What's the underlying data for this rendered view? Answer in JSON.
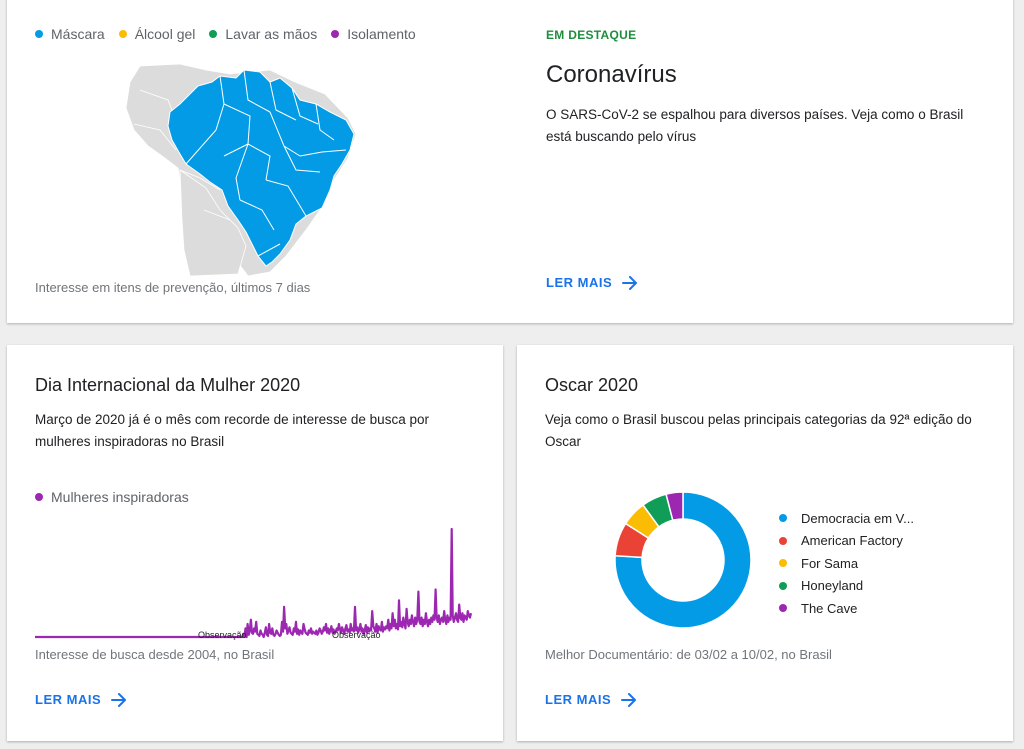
{
  "colors": {
    "mascara": "#039be5",
    "alcool": "#fbbc04",
    "lavar": "#0f9d58",
    "isolamento": "#9c27b0",
    "accent_blue": "#1a73e8",
    "accent_green": "#1e8e3e",
    "map_gray": "#dcdcdc",
    "brazil_blue": "#039be5"
  },
  "corona": {
    "legend": [
      {
        "label": "Máscara",
        "color": "#039be5"
      },
      {
        "label": "Álcool gel",
        "color": "#fbbc04"
      },
      {
        "label": "Lavar as mãos",
        "color": "#0f9d58"
      },
      {
        "label": "Isolamento",
        "color": "#9c27b0"
      }
    ],
    "map_caption": "Interesse em itens de prevenção, últimos 7 dias",
    "eyebrow": "EM DESTAQUE",
    "title": "Coronavírus",
    "description": "O SARS-CoV-2 se espalhou para diversos países. Veja como o Brasil está buscando pelo vírus",
    "read_more": "LER MAIS",
    "arrow_icon": "arrow-right-icon"
  },
  "mulher": {
    "title": "Dia Internacional da Mulher 2020",
    "description": "Março de 2020 já é o mês com recorde de interesse de busca por mulheres inspiradoras no Brasil",
    "legend_label": "Mulheres inspiradoras",
    "legend_color": "#9c27b0",
    "annotations": [
      "Observação",
      "Observação"
    ],
    "caption": "Interesse de busca desde 2004, no Brasil",
    "read_more": "LER MAIS"
  },
  "oscar": {
    "title": "Oscar 2020",
    "description": "Veja como o Brasil buscou pelas principais categorias da 92ª edição do Oscar",
    "caption": "Melhor Documentário: de 03/02 a 10/02, no Brasil",
    "read_more": "LER MAIS"
  },
  "chart_data": [
    {
      "type": "line",
      "series": [
        {
          "name": "Mulheres inspiradoras",
          "values": [
            0,
            0,
            0,
            0,
            0,
            0,
            0,
            0,
            0,
            0,
            0,
            0,
            0,
            0,
            0,
            0,
            0,
            0,
            0,
            0,
            0,
            0,
            0,
            0,
            0,
            0,
            0,
            0,
            0,
            0,
            0,
            0,
            0,
            0,
            0,
            0,
            0,
            0,
            0,
            0,
            0,
            0,
            0,
            0,
            0,
            0,
            0,
            0,
            0,
            0,
            0,
            0,
            0,
            0,
            0,
            0,
            0,
            0,
            0,
            0,
            0,
            0,
            0,
            0,
            0,
            0,
            0,
            0,
            0,
            0,
            0,
            0,
            0,
            0,
            0,
            0,
            0,
            0,
            0,
            0,
            0,
            0,
            0,
            0,
            0,
            0,
            0,
            0,
            0,
            0,
            0,
            0,
            0,
            0,
            0,
            0,
            0,
            0,
            0,
            0,
            0,
            0,
            0,
            0,
            0,
            0,
            0,
            0,
            0,
            0,
            0,
            0,
            0,
            0,
            0,
            0,
            0,
            0,
            0,
            0,
            0,
            0,
            0,
            0,
            0,
            0,
            0,
            0,
            0,
            0,
            0,
            0,
            0,
            0,
            0,
            0,
            0,
            0,
            0,
            0,
            0,
            0,
            0,
            0,
            0,
            0,
            0,
            0,
            0,
            0,
            0,
            0,
            0,
            0,
            0,
            0,
            0,
            0,
            0,
            0,
            0,
            0,
            0,
            0,
            0,
            0,
            0,
            0,
            0,
            0,
            0,
            0,
            0,
            0,
            0,
            0,
            0,
            0,
            0,
            0,
            0,
            0,
            0,
            0,
            0,
            0,
            0,
            0,
            0,
            0,
            0,
            0,
            0,
            0,
            3,
            0,
            8,
            0,
            12,
            2,
            6,
            16,
            4,
            3,
            8,
            5,
            14,
            3,
            2,
            1,
            6,
            3,
            2,
            0,
            4,
            9,
            2,
            1,
            12,
            4,
            3,
            8,
            2,
            1,
            3,
            6,
            4,
            2,
            1,
            2,
            14,
            5,
            28,
            8,
            12,
            3,
            6,
            9,
            4,
            3,
            2,
            8,
            5,
            14,
            3,
            7,
            2,
            6,
            4,
            3,
            12,
            8,
            4,
            3,
            2,
            6,
            4,
            8,
            3,
            5,
            4,
            3,
            6,
            2,
            4,
            8,
            6,
            3,
            5,
            9,
            6,
            12,
            4,
            8,
            3,
            6,
            10,
            4,
            7,
            3,
            5,
            8,
            6,
            12,
            7,
            4,
            9,
            6,
            3,
            8,
            11,
            5,
            7,
            4,
            12,
            6,
            8,
            5,
            28,
            6,
            9,
            4,
            7,
            12,
            5,
            8,
            3,
            6,
            11,
            4,
            9,
            5,
            8,
            6,
            24,
            10,
            8,
            5,
            12,
            4,
            10,
            7,
            6,
            14,
            5,
            9,
            7,
            10,
            8,
            16,
            6,
            12,
            8,
            22,
            10,
            16,
            8,
            12,
            7,
            34,
            10,
            14,
            9,
            18,
            12,
            8,
            26,
            14,
            10,
            16,
            12,
            20,
            14,
            10,
            18,
            12,
            16,
            42,
            14,
            12,
            18,
            10,
            16,
            12,
            22,
            14,
            10,
            16,
            12,
            18,
            14,
            20,
            16,
            44,
            18,
            14,
            20,
            12,
            16,
            18,
            14,
            24,
            16,
            12,
            20,
            14,
            18,
            16,
            100,
            20,
            14,
            18,
            22,
            16,
            14,
            30,
            18,
            16,
            22,
            14,
            20,
            18,
            16,
            24,
            20,
            18,
            22
          ]
        }
      ],
      "ylim": [
        0,
        100
      ],
      "annotations": [
        "Observação",
        "Observação"
      ]
    },
    {
      "type": "pie",
      "categories": [
        "Democracia em V...",
        "American Factory",
        "For Sama",
        "Honeyland",
        "The Cave"
      ],
      "values": [
        76,
        8,
        6,
        6,
        4
      ],
      "colors": [
        "#039be5",
        "#ea4335",
        "#fbbc04",
        "#0f9d58",
        "#9c27b0"
      ]
    }
  ]
}
